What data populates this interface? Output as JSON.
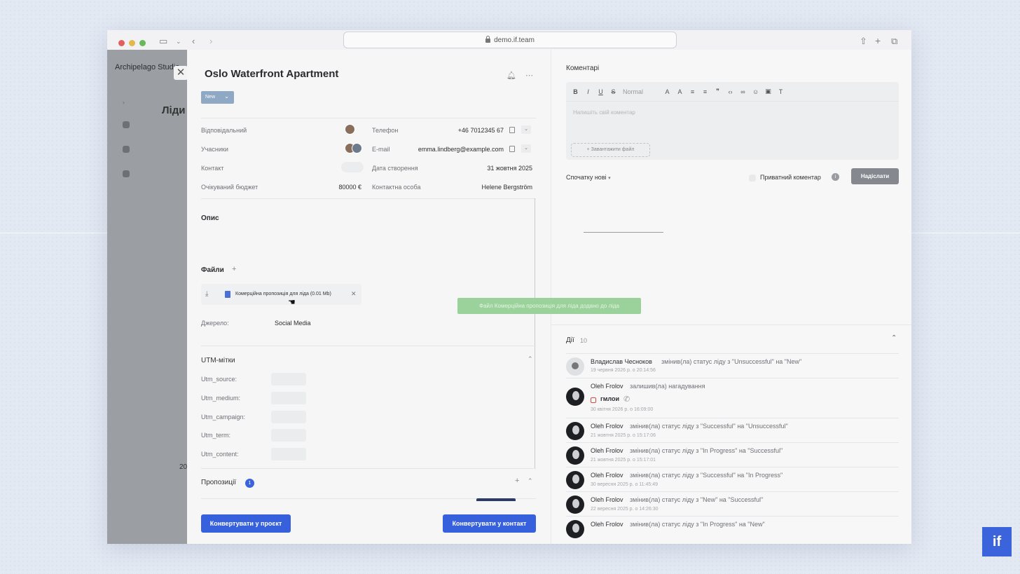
{
  "browser": {
    "url": "demo.if.team"
  },
  "underlay": {
    "brand": "Archipelago Studio",
    "page_title": "Ліди",
    "year_fragment": "20"
  },
  "lead": {
    "title": "Oslo Waterfront Apartment",
    "status": "New",
    "fields": {
      "responsible_label": "Відповідальний",
      "participants_label": "Учасники",
      "contact_label": "Контакт",
      "budget_label": "Очікуваний бюджет",
      "budget_value": "80000 €",
      "phone_label": "Телефон",
      "phone_value": "+46 7012345 67",
      "email_label": "E-mail",
      "email_value": "emma.lindberg@example.com",
      "created_label": "Дата створення",
      "created_value": "31 жовтня 2025",
      "contact_person_label": "Контактна особа",
      "contact_person_value": "Helene Bergström"
    },
    "description_title": "Опис",
    "files_title": "Файли",
    "file": {
      "name": "Комерційна пропозиція для ліда (0.01 Mb)"
    },
    "source_label": "Джерело:",
    "source_value": "Social Media",
    "utm_title": "UTM-мітки",
    "utm": [
      {
        "label": "Utm_source:"
      },
      {
        "label": "Utm_medium:"
      },
      {
        "label": "Utm_campaign:"
      },
      {
        "label": "Utm_term:"
      },
      {
        "label": "Utm_content:"
      }
    ],
    "proposals_title": "Пропозиції",
    "proposals_count": "1",
    "convert_project_label": "Конвертувати у проєкт",
    "convert_contact_label": "Конвертувати у контакт"
  },
  "comments": {
    "title": "Коментарі",
    "format_label": "Normal",
    "placeholder": "Напишіть свій коментар",
    "upload_label": "+ Завантажити файл",
    "sort_label": "Спочатку нові",
    "private_label": "Приватний коментар",
    "send_label": "Надіслати"
  },
  "toast": {
    "message": "Файл Комерційна пропозиція для ліда додано до ліда"
  },
  "activity": {
    "title": "Дії",
    "count": "10",
    "items": [
      {
        "name": "Владислав Чесноков",
        "text": "змінив(ла) статус ліду з \"Unsuccessful\" на \"New\"",
        "date": "19 червня 2026 р. о 20:14:56"
      },
      {
        "name": "Oleh Frolov",
        "text": "залишив(ла) нагадування",
        "reminder": "гмлои",
        "date": "30 квітня 2026 р. о 16:09:00"
      },
      {
        "name": "Oleh Frolov",
        "text": "змінив(ла) статус ліду з \"Successful\" на \"Unsuccessful\"",
        "date": "21 жовтня 2025 р. о 15:17:06"
      },
      {
        "name": "Oleh Frolov",
        "text": "змінив(ла) статус ліду з \"In Progress\" на \"Successful\"",
        "date": "21 жовтня 2025 р. о 15:17:01"
      },
      {
        "name": "Oleh Frolov",
        "text": "змінив(ла) статус ліду з \"Successful\" на \"In Progress\"",
        "date": "30 вересня 2025 р. о 11:45:49"
      },
      {
        "name": "Oleh Frolov",
        "text": "змінив(ла) статус ліду з \"New\" на \"Successful\"",
        "date": "22 вересня 2025 р. о 14:26:30"
      },
      {
        "name": "Oleh Frolov",
        "text": "змінив(ла) статус ліду з \"In Progress\" на \"New\"",
        "date": ""
      }
    ]
  },
  "logo": {
    "text": "if"
  },
  "colors": {
    "accent": "#3760dc",
    "toast": "#9bd19a",
    "status": "#8fa8c4"
  }
}
